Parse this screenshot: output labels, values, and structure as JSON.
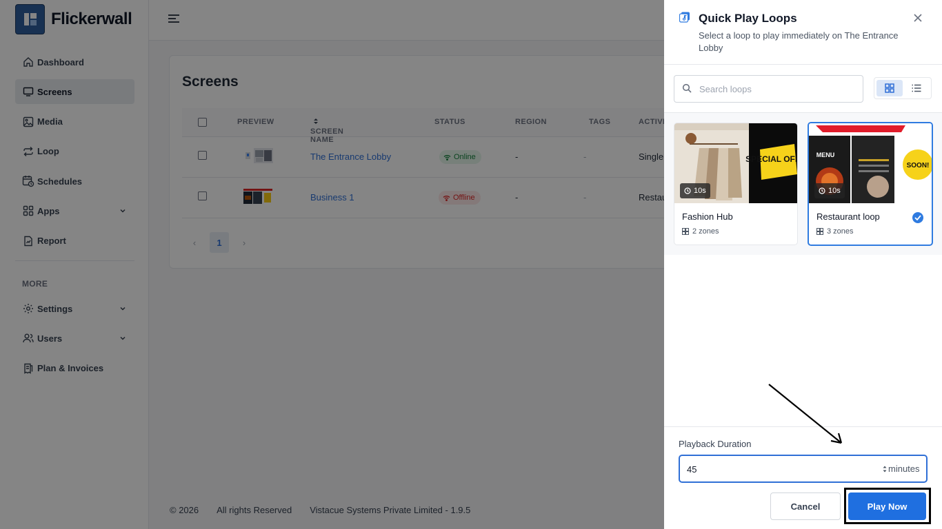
{
  "brand": {
    "name": "Flickerwall"
  },
  "nav": {
    "items": [
      {
        "label": "Dashboard",
        "icon": "home-icon"
      },
      {
        "label": "Screens",
        "icon": "monitor-icon",
        "active": true
      },
      {
        "label": "Media",
        "icon": "image-icon"
      },
      {
        "label": "Loop",
        "icon": "repeat-icon"
      },
      {
        "label": "Schedules",
        "icon": "calendar-icon"
      },
      {
        "label": "Apps",
        "icon": "apps-grid-icon",
        "expandable": true
      },
      {
        "label": "Report",
        "icon": "report-icon"
      }
    ],
    "more_label": "MORE",
    "more_items": [
      {
        "label": "Settings",
        "icon": "gear-icon",
        "expandable": true
      },
      {
        "label": "Users",
        "icon": "users-icon",
        "expandable": true
      },
      {
        "label": "Plan & Invoices",
        "icon": "invoice-icon"
      }
    ]
  },
  "screens": {
    "title": "Screens",
    "columns": [
      "PREVIEW",
      "SCREEN NAME",
      "STATUS",
      "REGION",
      "TAGS",
      "ACTIVE"
    ],
    "rows": [
      {
        "name": "The Entrance Lobby",
        "status": "Online",
        "region": "-",
        "tags": "-",
        "active": "Single"
      },
      {
        "name": "Business 1",
        "status": "Offline",
        "region": "-",
        "tags": "-",
        "active": "Restau"
      }
    ],
    "pagination": {
      "prev": "‹",
      "current": "1",
      "next": "›"
    }
  },
  "footer": {
    "copyright": "© 2026",
    "rights": "All rights Reserved",
    "company": "Vistacue Systems Private Limited - 1.9.5"
  },
  "drawer": {
    "title": "Quick Play Loops",
    "subtitle": "Select a loop to play immediately on The Entrance Lobby",
    "search_placeholder": "Search loops",
    "view_mode": "grid",
    "loops": [
      {
        "name": "Fashion Hub",
        "duration": "10s",
        "zones": "2 zones",
        "selected": false,
        "preview_text": "SPECIAL OFFER"
      },
      {
        "name": "Restaurant loop",
        "duration": "10s",
        "zones": "3 zones",
        "selected": true,
        "preview_menu": "MENU",
        "preview_soon": "SOON!"
      }
    ],
    "playback": {
      "label": "Playback Duration",
      "value": "45",
      "unit": "minutes"
    },
    "cancel_label": "Cancel",
    "play_label": "Play Now"
  },
  "colors": {
    "accent": "#1f6fe0",
    "online": "#15803d",
    "offline": "#dc2626",
    "selected_border": "#2f7be0"
  }
}
